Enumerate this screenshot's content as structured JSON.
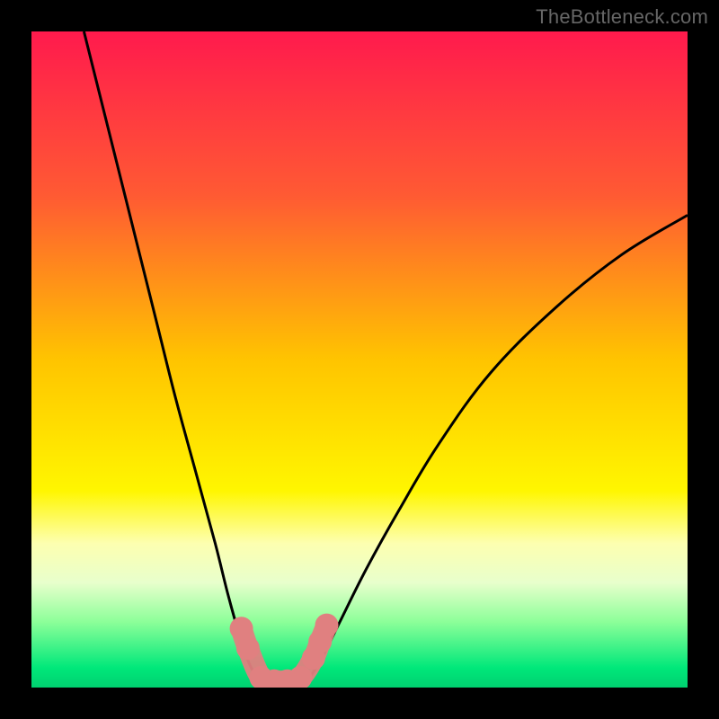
{
  "watermark": "TheBottleneck.com",
  "chart_data": {
    "type": "line",
    "title": "",
    "xlabel": "",
    "ylabel": "",
    "xlim": [
      0,
      100
    ],
    "ylim": [
      0,
      100
    ],
    "grid": false,
    "background_gradient": {
      "stops": [
        {
          "offset": 0,
          "color": "#ff1a4d"
        },
        {
          "offset": 25,
          "color": "#ff5a33"
        },
        {
          "offset": 50,
          "color": "#ffc400"
        },
        {
          "offset": 70,
          "color": "#fff600"
        },
        {
          "offset": 78,
          "color": "#fdffb0"
        },
        {
          "offset": 84,
          "color": "#e8ffcc"
        },
        {
          "offset": 90,
          "color": "#8cff99"
        },
        {
          "offset": 97,
          "color": "#00e87a"
        },
        {
          "offset": 100,
          "color": "#00d070"
        }
      ]
    },
    "series": [
      {
        "name": "left-curve",
        "type": "line",
        "color": "#000000",
        "points": [
          {
            "x": 8,
            "y": 100
          },
          {
            "x": 10,
            "y": 92
          },
          {
            "x": 13,
            "y": 80
          },
          {
            "x": 16,
            "y": 68
          },
          {
            "x": 19,
            "y": 56
          },
          {
            "x": 22,
            "y": 44
          },
          {
            "x": 25,
            "y": 33
          },
          {
            "x": 28,
            "y": 22
          },
          {
            "x": 30,
            "y": 14
          },
          {
            "x": 32,
            "y": 7
          },
          {
            "x": 33.5,
            "y": 3
          },
          {
            "x": 35,
            "y": 1
          }
        ]
      },
      {
        "name": "right-curve",
        "type": "line",
        "color": "#000000",
        "points": [
          {
            "x": 42,
            "y": 1
          },
          {
            "x": 44,
            "y": 4
          },
          {
            "x": 47,
            "y": 10
          },
          {
            "x": 51,
            "y": 18
          },
          {
            "x": 56,
            "y": 27
          },
          {
            "x": 62,
            "y": 37
          },
          {
            "x": 70,
            "y": 48
          },
          {
            "x": 80,
            "y": 58
          },
          {
            "x": 90,
            "y": 66
          },
          {
            "x": 100,
            "y": 72
          }
        ]
      },
      {
        "name": "optimal-region-markers",
        "type": "scatter",
        "color": "#e08080",
        "shape": "rounded-bar",
        "points": [
          {
            "x": 32,
            "y": 9
          },
          {
            "x": 33,
            "y": 6
          },
          {
            "x": 35,
            "y": 1.5
          },
          {
            "x": 37,
            "y": 1
          },
          {
            "x": 39,
            "y": 1
          },
          {
            "x": 41,
            "y": 1.5
          },
          {
            "x": 43,
            "y": 4.5
          },
          {
            "x": 44,
            "y": 7
          },
          {
            "x": 45,
            "y": 9.5
          }
        ]
      }
    ],
    "annotations": []
  }
}
